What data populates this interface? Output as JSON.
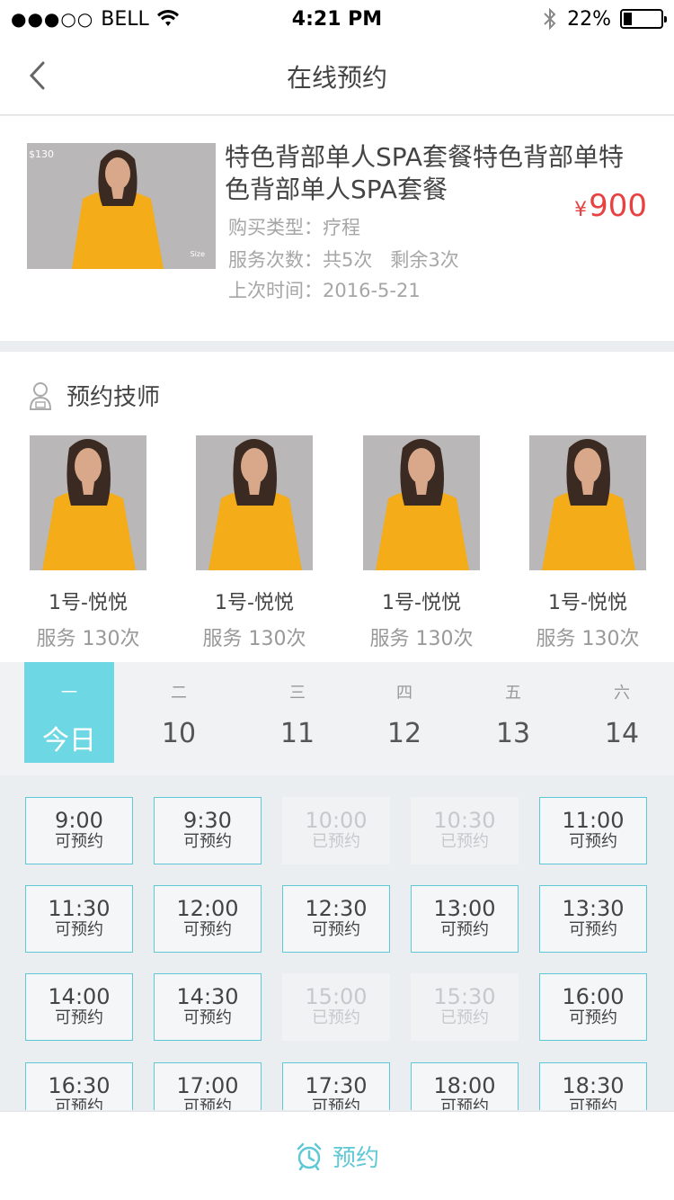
{
  "status_bar": {
    "carrier": "BELL",
    "signal": "●●●○○",
    "time": "4:21 PM",
    "battery": "22%",
    "battery_level": 0.22
  },
  "nav": {
    "title": "在线预约",
    "back_icon": "chevron-left-icon"
  },
  "product": {
    "title": "特色背部单人SPA套餐特色背部单特色背部单人SPA套餐",
    "image_price_tag": "$130",
    "image_size_tag": "Size",
    "purchase_type_label": "购买类型：",
    "purchase_type": "疗程",
    "service_count_label": "服务次数：",
    "service_total": "共5次",
    "service_remaining": "剩余3次",
    "last_time_label": "上次时间：",
    "last_time": "2016-5-21",
    "price_symbol": "¥",
    "price": "900",
    "price_color": "#e84142"
  },
  "technicians": {
    "title": "预约技师",
    "icon": "technician-icon",
    "items": [
      {
        "name": "1号-悦悦",
        "count": "服务 130次"
      },
      {
        "name": "1号-悦悦",
        "count": "服务 130次"
      },
      {
        "name": "1号-悦悦",
        "count": "服务 130次"
      },
      {
        "name": "1号-悦悦",
        "count": "服务 130次"
      }
    ]
  },
  "days": [
    {
      "weekday": "一",
      "date": "今日",
      "selected": true
    },
    {
      "weekday": "二",
      "date": "10"
    },
    {
      "weekday": "三",
      "date": "11"
    },
    {
      "weekday": "四",
      "date": "12"
    },
    {
      "weekday": "五",
      "date": "13"
    },
    {
      "weekday": "六",
      "date": "14"
    }
  ],
  "slots": [
    {
      "time": "9:00",
      "status": "可预约",
      "available": true
    },
    {
      "time": "9:30",
      "status": "可预约",
      "available": true
    },
    {
      "time": "10:00",
      "status": "已预约",
      "available": false
    },
    {
      "time": "10:30",
      "status": "已预约",
      "available": false
    },
    {
      "time": "11:00",
      "status": "可预约",
      "available": true
    },
    {
      "time": "11:30",
      "status": "可预约",
      "available": true
    },
    {
      "time": "12:00",
      "status": "可预约",
      "available": true
    },
    {
      "time": "12:30",
      "status": "可预约",
      "available": true
    },
    {
      "time": "13:00",
      "status": "可预约",
      "available": true
    },
    {
      "time": "13:30",
      "status": "可预约",
      "available": true
    },
    {
      "time": "14:00",
      "status": "可预约",
      "available": true
    },
    {
      "time": "14:30",
      "status": "可预约",
      "available": true
    },
    {
      "time": "15:00",
      "status": "已预约",
      "available": false
    },
    {
      "time": "15:30",
      "status": "已预约",
      "available": false
    },
    {
      "time": "16:00",
      "status": "可预约",
      "available": true
    },
    {
      "time": "16:30",
      "status": "可预约",
      "available": true
    },
    {
      "time": "17:00",
      "status": "可预约",
      "available": true
    },
    {
      "time": "17:30",
      "status": "可预约",
      "available": true
    },
    {
      "time": "18:00",
      "status": "可预约",
      "available": true
    },
    {
      "time": "18:30",
      "status": "可预约",
      "available": true
    }
  ],
  "bottom": {
    "book_label": "预约",
    "icon": "alarm-clock-icon",
    "accent": "#5fc8d6"
  },
  "colors": {
    "accent": "#6dd7e3",
    "price": "#e84142"
  }
}
